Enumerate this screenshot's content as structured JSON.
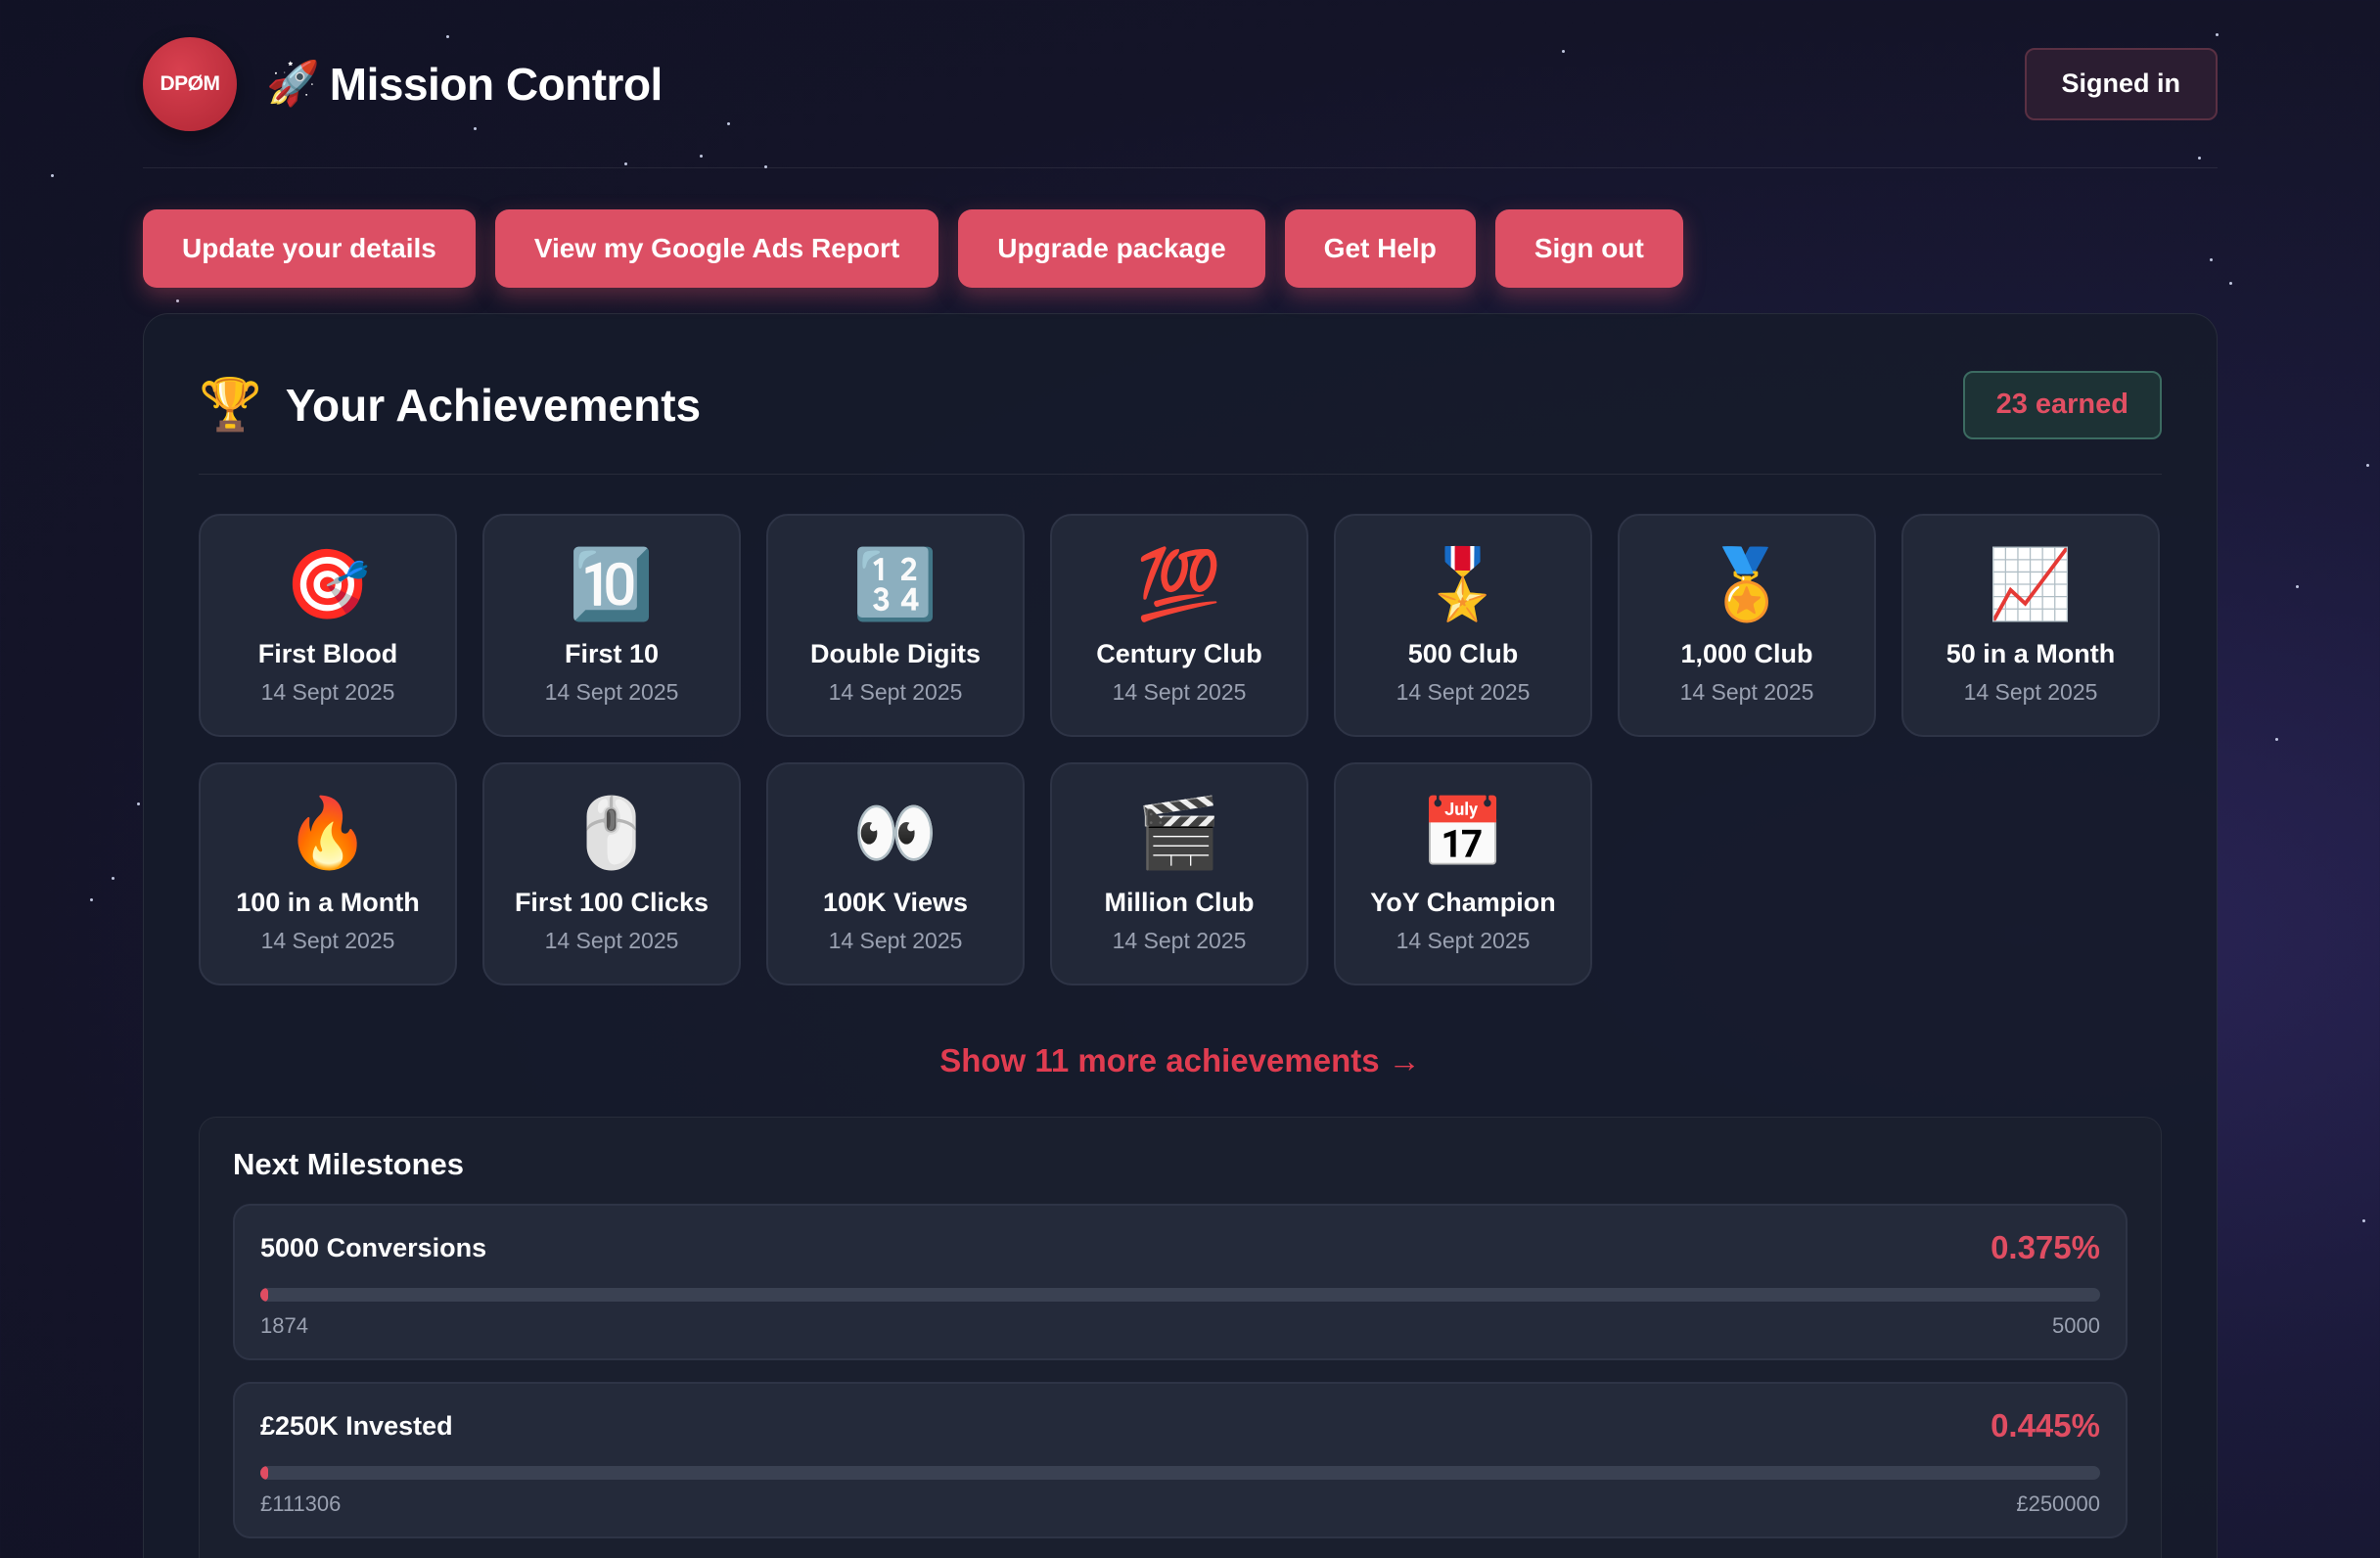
{
  "header": {
    "logo_text": "DPØM",
    "rocket_icon": "🚀",
    "app_title": "Mission Control",
    "signed_in_label": "Signed in"
  },
  "nav": [
    {
      "label": "Update your details"
    },
    {
      "label": "View my Google Ads Report"
    },
    {
      "label": "Upgrade package"
    },
    {
      "label": "Get Help"
    },
    {
      "label": "Sign out"
    }
  ],
  "achievements": {
    "trophy_icon": "🏆",
    "title": "Your Achievements",
    "earned_badge": "23 earned",
    "items": [
      {
        "icon": "🎯",
        "name": "First Blood",
        "date": "14 Sept 2025"
      },
      {
        "icon": "🔟",
        "name": "First 10",
        "date": "14 Sept 2025"
      },
      {
        "icon": "🔢",
        "name": "Double Digits",
        "date": "14 Sept 2025"
      },
      {
        "icon": "💯",
        "name": "Century Club",
        "date": "14 Sept 2025"
      },
      {
        "icon": "🎖️",
        "name": "500 Club",
        "date": "14 Sept 2025"
      },
      {
        "icon": "🏅",
        "name": "1,000 Club",
        "date": "14 Sept 2025"
      },
      {
        "icon": "📈",
        "name": "50 in a Month",
        "date": "14 Sept 2025"
      },
      {
        "icon": "🔥",
        "name": "100 in a Month",
        "date": "14 Sept 2025"
      },
      {
        "icon": "🖱️",
        "name": "First 100 Clicks",
        "date": "14 Sept 2025"
      },
      {
        "icon": "👀",
        "name": "100K Views",
        "date": "14 Sept 2025"
      },
      {
        "icon": "🎬",
        "name": "Million Club",
        "date": "14 Sept 2025"
      },
      {
        "icon": "📅",
        "name": "YoY Champion",
        "date": "14 Sept 2025"
      }
    ],
    "show_more_label": "Show 11 more achievements →"
  },
  "milestones": {
    "title": "Next Milestones",
    "items": [
      {
        "name": "5000 Conversions",
        "percent_label": "0.375%",
        "progress": 0.375,
        "current": "1874",
        "target": "5000"
      },
      {
        "name": "£250K Invested",
        "percent_label": "0.445%",
        "progress": 0.445,
        "current": "£111306",
        "target": "£250000"
      }
    ]
  },
  "colors": {
    "accent": "#dc4f64",
    "accent_text": "#e03c50",
    "badge_border": "#3c6b61",
    "card_bg": "#161b2a",
    "tile_bg": "#222838"
  }
}
